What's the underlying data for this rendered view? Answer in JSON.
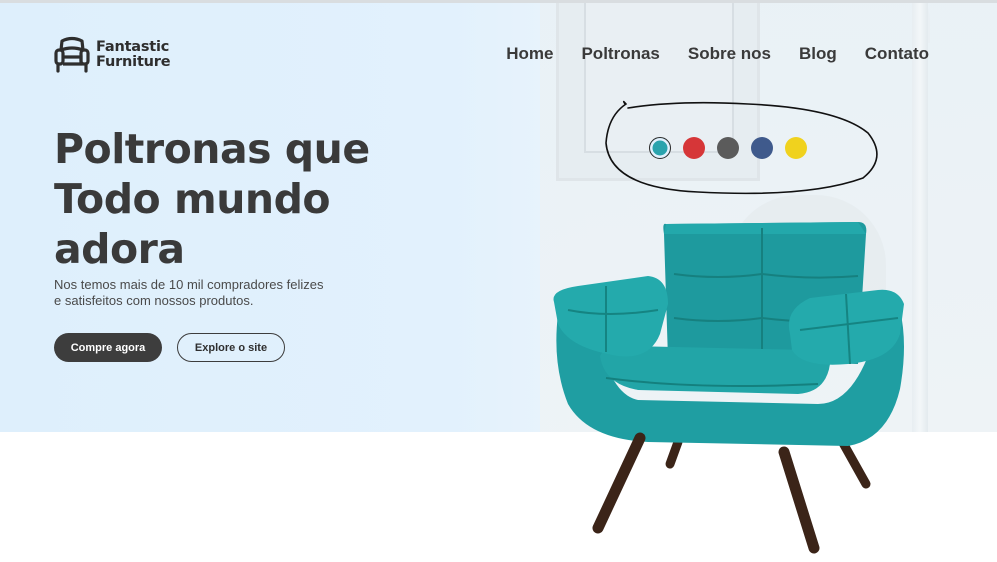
{
  "brand": {
    "line1": "Fantastic",
    "line2": "Furniture",
    "icon": "armchair-logo-icon"
  },
  "nav": {
    "items": [
      {
        "label": "Home"
      },
      {
        "label": "Poltronas"
      },
      {
        "label": "Sobre nos"
      },
      {
        "label": "Blog"
      },
      {
        "label": "Contato"
      }
    ]
  },
  "hero": {
    "title_line1": "Poltronas que",
    "title_line2": "Todo mundo",
    "title_line3": "adora",
    "subtitle_line1": "Nos temos mais de 10 mil compradores felizes",
    "subtitle_line2": "e satisfeitos com nossos produtos.",
    "primary_button": "Compre agora",
    "secondary_button": "Explore o site"
  },
  "color_options": [
    {
      "color": "#2aa3ad",
      "selected": true
    },
    {
      "color": "#d63638",
      "selected": false
    },
    {
      "color": "#5b5b5b",
      "selected": false
    },
    {
      "color": "#3f5a8c",
      "selected": false
    },
    {
      "color": "#f0d21e",
      "selected": false
    }
  ],
  "colors": {
    "accent_dark": "#3d3d3d",
    "hero_bg": "#e2f1fd",
    "chair": "#1f9ea2",
    "chair_legs": "#3b2418"
  }
}
